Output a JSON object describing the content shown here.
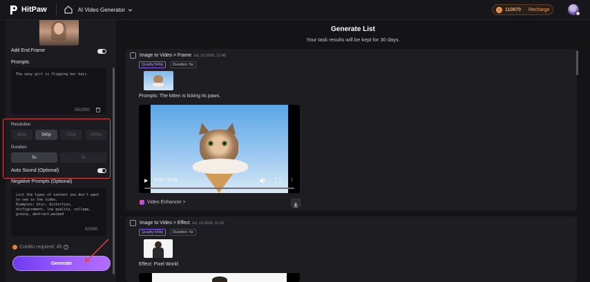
{
  "topbar": {
    "brand": "HitPaw",
    "nav_title": "AI Video Generator",
    "credits_value": "110870",
    "recharge_label": "Recharge"
  },
  "left_panel": {
    "add_end_frame_label": "Add End Frame",
    "prompts_label": "Prompts",
    "prompt_text": "The sexy girl is flipping her hair.",
    "prompt_count": "35/2000",
    "resolution_label": "Resolution",
    "resolution_options": [
      "360p",
      "540p",
      "720p",
      "1080p"
    ],
    "resolution_selected": "540p",
    "duration_label": "Duration",
    "duration_options": [
      "5s",
      "8s"
    ],
    "duration_selected": "5s",
    "auto_sound_label": "Auto Sound (Optional)",
    "negative_prompts_label": "Negative Prompts (Optional)",
    "negative_prompt_text": "List the types of content you don't want to see in the video.\nExamples: blur, distortion, disfigurement, low quality, collage, grainy, abstract,warped",
    "negative_count": "0/2000",
    "credits_required": "Credits required: 45",
    "generate_label": "Generate"
  },
  "main": {
    "title": "Generate List",
    "subtitle": "Your task results will be kept for 30 days.",
    "tasks": [
      {
        "title": "Image to Video > Frame",
        "date": "Jul, 10,2025, 12:45",
        "quality": "Quality:540p",
        "duration": "Duration: 5s",
        "prompt": "Prompts:  The kitten is licking its paws.",
        "time_display": "0:00 / 0:05",
        "enhancer_label": "Video Enhancer >"
      },
      {
        "title": "Image to Video > Effect",
        "date": "Jul, 10,2025, 11:23",
        "quality": "Quality:540p",
        "duration": "Duration: 5s",
        "effect": "Effect: Pixel World"
      }
    ]
  },
  "colors": {
    "accent_purple": "#8b5cf6",
    "highlight_red": "#e0454b",
    "credits_orange": "#f1a35c"
  }
}
